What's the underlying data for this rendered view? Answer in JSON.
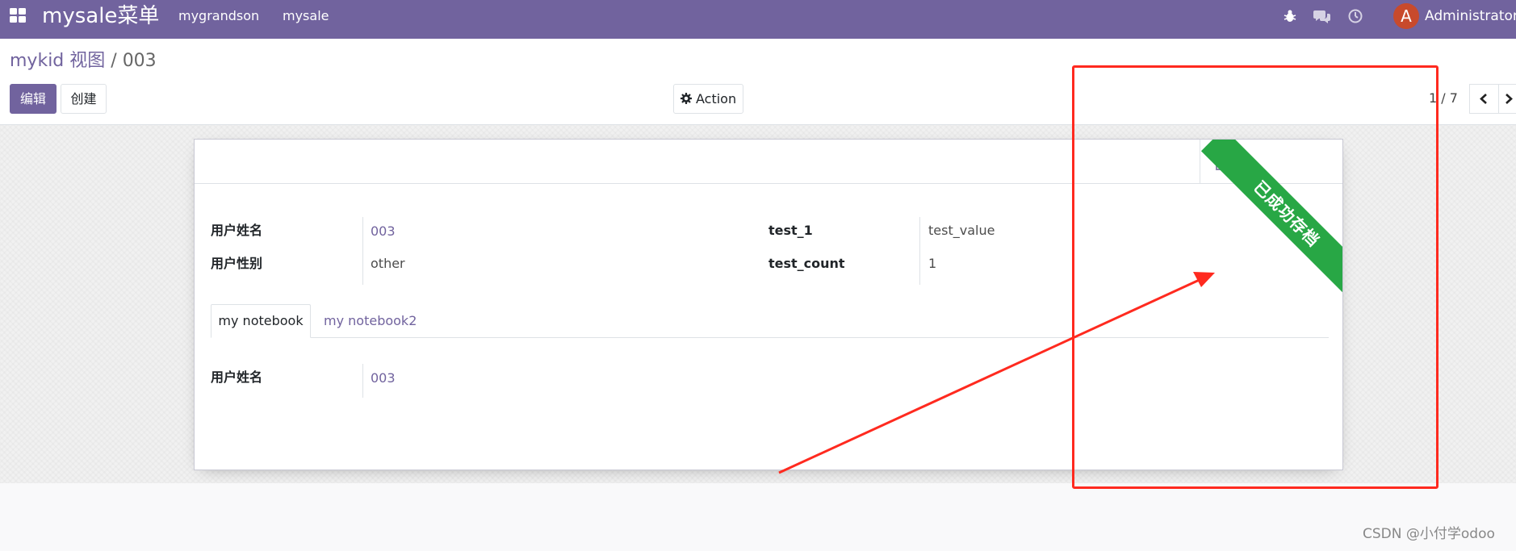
{
  "navbar": {
    "brand": "mysale菜单",
    "menu": [
      "mygrandson",
      "mysale"
    ],
    "avatar_letter": "A",
    "user_name": "Administrator (fi"
  },
  "control_panel": {
    "breadcrumb": {
      "parent": "mykid 视图",
      "separator": "/",
      "current": "003"
    },
    "edit_label": "编辑",
    "create_label": "创建",
    "action_label": "Action",
    "pager_value": "1 / 7"
  },
  "form": {
    "fields_left": [
      {
        "label": "用户姓名",
        "value": "003"
      },
      {
        "label": "用户性别",
        "value": "other"
      }
    ],
    "fields_right": [
      {
        "label": "test_1",
        "value": "test_value"
      },
      {
        "label": "test_count",
        "value": "1"
      }
    ],
    "ribbon_text": "已成功存档",
    "notebook": {
      "tabs": [
        "my notebook",
        "my notebook2"
      ],
      "active_tab": "my notebook",
      "page_fields": [
        {
          "label": "用户姓名",
          "value": "003"
        }
      ]
    }
  },
  "watermark": "CSDN @小付学odoo",
  "colors": {
    "brand": "#71639e",
    "ribbon": "#28a745",
    "annotation": "#ff2a1f",
    "avatar": "#c84a2c"
  }
}
